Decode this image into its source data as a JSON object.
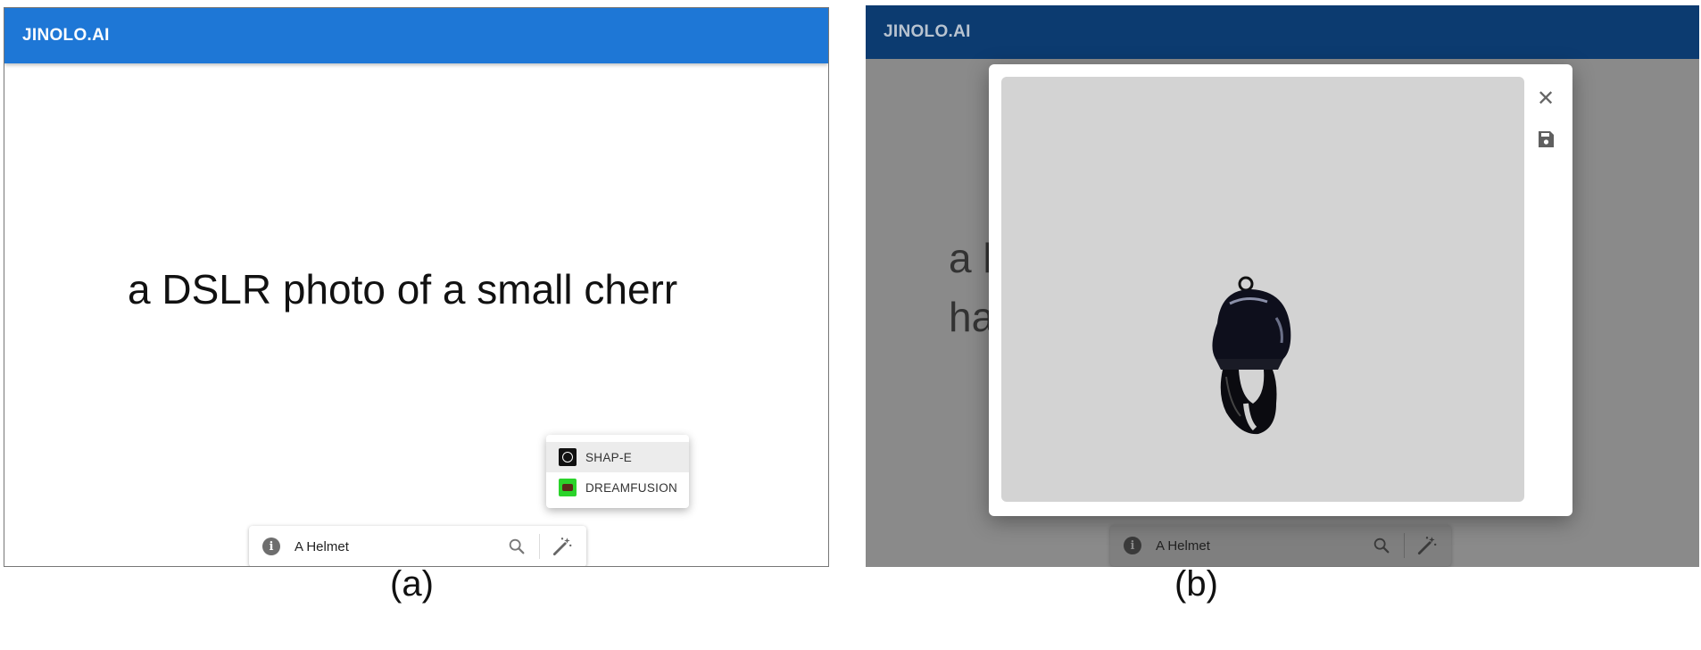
{
  "app": {
    "title": "JINOLO.AI"
  },
  "panel_a": {
    "prompt_display": "a DSLR photo of a small cherr",
    "search": {
      "value": "A Helmet",
      "placeholder": ""
    },
    "model_menu": {
      "items": [
        {
          "label": "SHAP-E",
          "icon": "openai-logo-icon",
          "active": true
        },
        {
          "label": "DREAMFUSION",
          "icon": "dreamfusion-logo-icon",
          "active": false
        }
      ]
    },
    "caption": "(a)"
  },
  "panel_b": {
    "prompt_display_lines": [
      "a h",
      "ha"
    ],
    "search": {
      "value": "A Helmet"
    },
    "dialog": {
      "close_icon": "close-icon",
      "save_icon": "save-icon",
      "model_render": "helmet-3d-render"
    },
    "caption": "(b)"
  },
  "colors": {
    "appbar_a": "#1e77d6",
    "appbar_b": "#0c3b70",
    "overlay": "#8a8a8a",
    "viewer_bg": "#d3d3d3"
  }
}
